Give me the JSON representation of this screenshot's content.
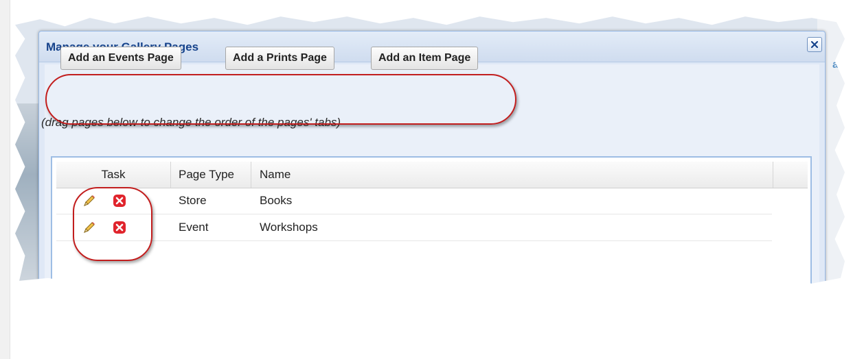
{
  "dialog": {
    "title": "Manage your Gallery Pages",
    "close_icon": "close-icon"
  },
  "toolbar": {
    "add_events_label": "Add an Events Page",
    "add_prints_label": "Add a Prints Page",
    "add_item_label": "Add an Item Page"
  },
  "hint": "(drag pages below to change the order of the pages' tabs)",
  "grid": {
    "columns": [
      "Task",
      "Page Type",
      "Name"
    ],
    "rows": [
      {
        "page_type": "Store",
        "name": "Books",
        "icons": [
          "pencil-icon",
          "delete-icon"
        ]
      },
      {
        "page_type": "Event",
        "name": "Workshops",
        "icons": [
          "pencil-icon",
          "delete-icon"
        ]
      }
    ]
  },
  "background": {
    "partial_text": "ag"
  },
  "colors": {
    "title": "#15428b",
    "header_bg": "#dfe8f6",
    "grid_border": "#9dbde4",
    "annotation": "#c21d1d",
    "delete_icon": "#e0242c",
    "pencil_icon": "#f2c14a"
  }
}
